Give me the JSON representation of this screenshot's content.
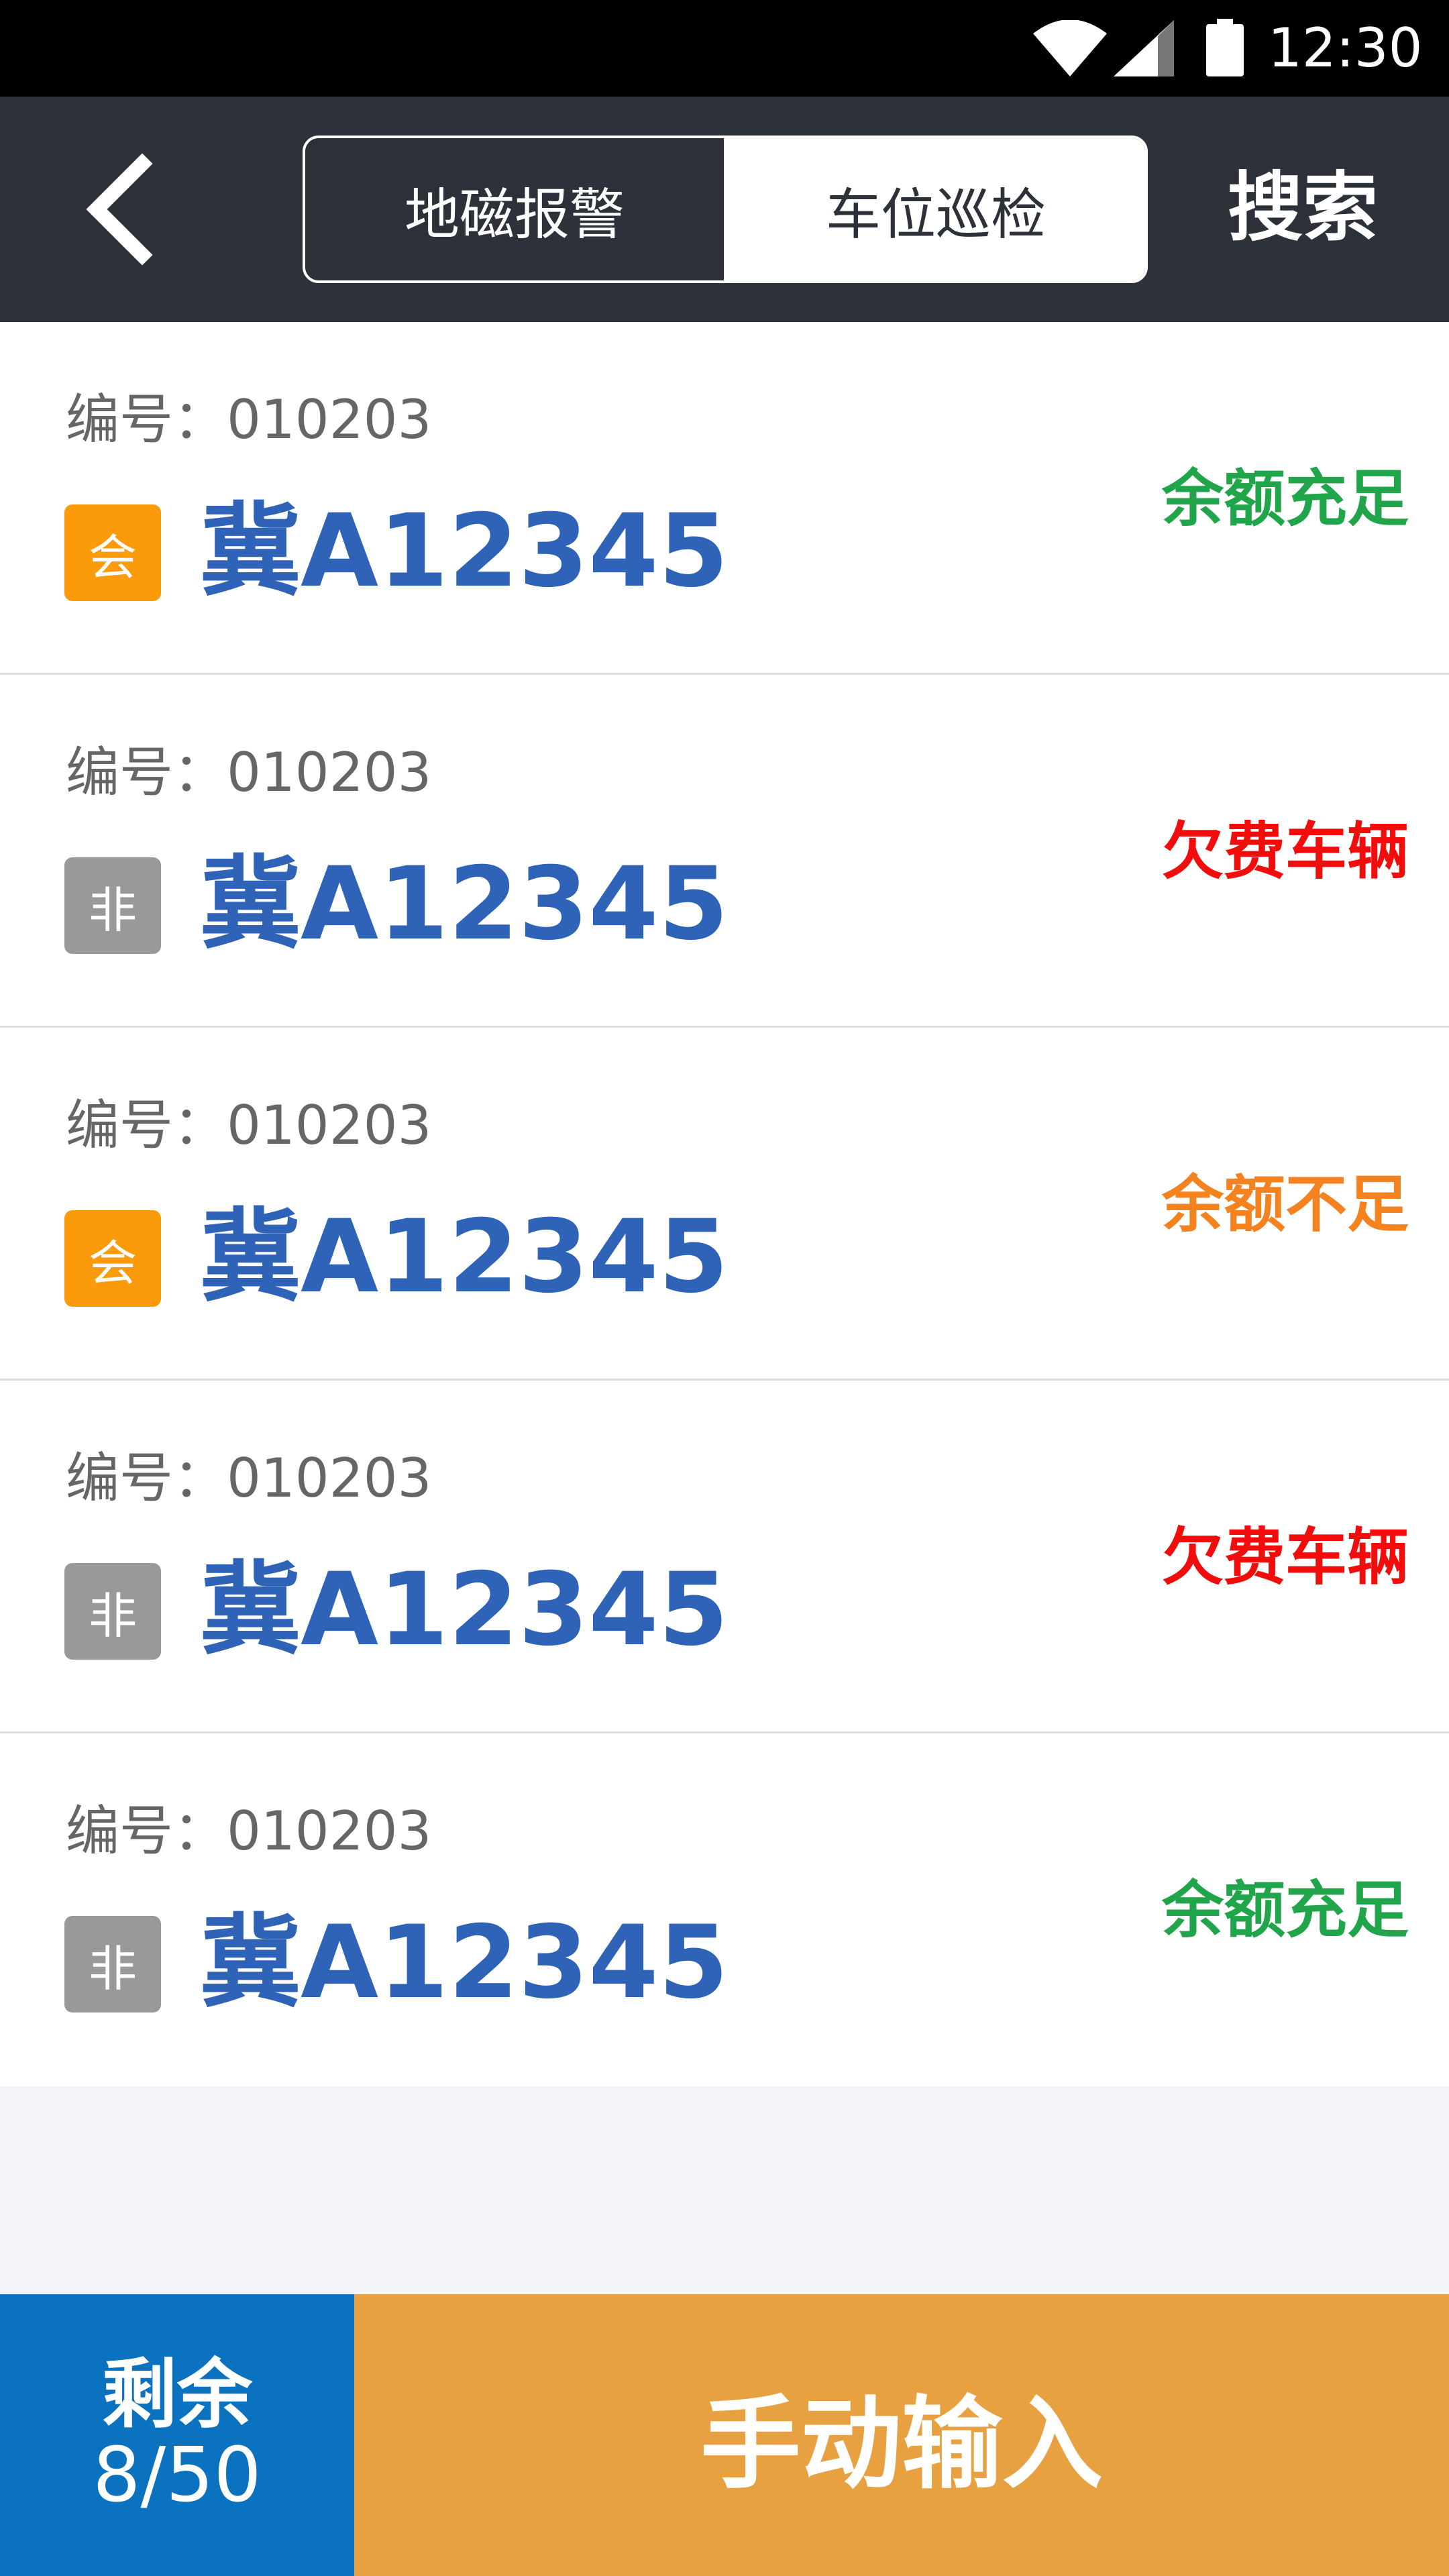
{
  "status_bar": {
    "time": "12:30",
    "wifi_icon": "wifi-icon",
    "signal_icon": "cell-signal-icon",
    "battery_icon": "battery-icon"
  },
  "header": {
    "back_icon": "chevron-left-icon",
    "tabs": [
      {
        "label": "地磁报警",
        "selected": false
      },
      {
        "label": "车位巡检",
        "selected": true
      }
    ],
    "search_label": "搜索"
  },
  "colors": {
    "sufficient": "#21a54a",
    "arrears": "#f20d0d",
    "insufficient": "#f4821f",
    "member_badge": "#fb9b0b",
    "nonmember_badge": "#999999",
    "plate": "#2f63b7"
  },
  "records": [
    {
      "number_label": "编号：010203",
      "badge": "会",
      "badge_type": "member",
      "plate": "冀A12345",
      "status": "余额充足",
      "status_type": "sufficient"
    },
    {
      "number_label": "编号：010203",
      "badge": "非",
      "badge_type": "nonmember",
      "plate": "冀A12345",
      "status": "欠费车辆",
      "status_type": "arrears"
    },
    {
      "number_label": "编号：010203",
      "badge": "会",
      "badge_type": "member",
      "plate": "冀A12345",
      "status": "余额不足",
      "status_type": "insufficient"
    },
    {
      "number_label": "编号：010203",
      "badge": "非",
      "badge_type": "nonmember",
      "plate": "冀A12345",
      "status": "欠费车辆",
      "status_type": "arrears"
    },
    {
      "number_label": "编号：010203",
      "badge": "非",
      "badge_type": "nonmember",
      "plate": "冀A12345",
      "status": "余额充足",
      "status_type": "sufficient"
    }
  ],
  "footer": {
    "remaining_label": "剩余",
    "remaining_count": "8/50",
    "manual_input_label": "手动输入"
  }
}
